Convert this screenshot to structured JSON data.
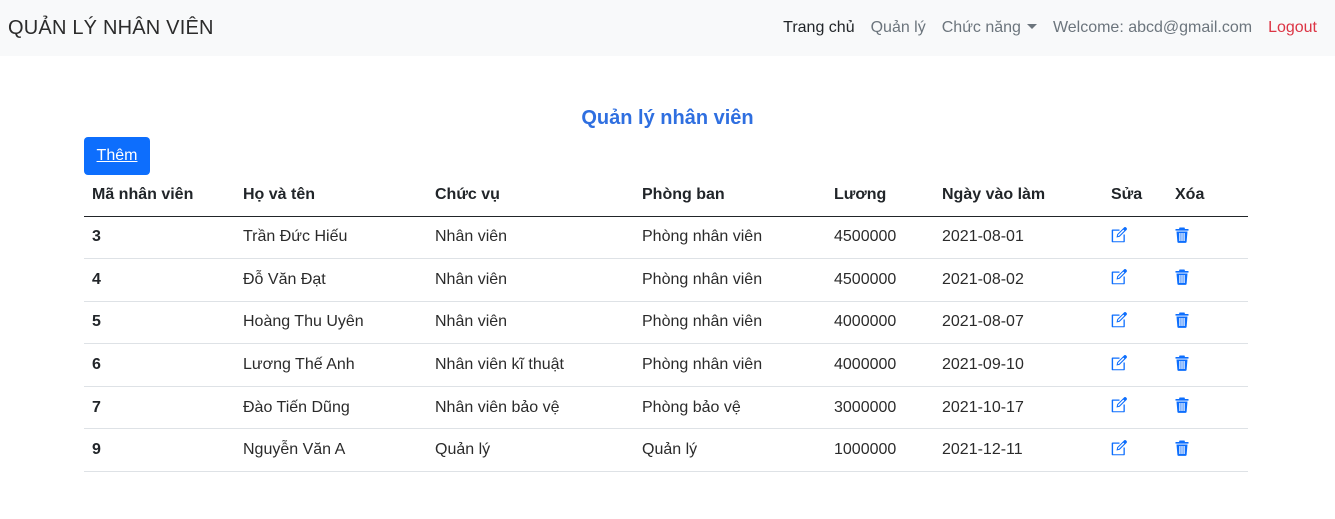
{
  "navbar": {
    "brand": "QUẢN LÝ NHÂN VIÊN",
    "links": {
      "home": "Trang chủ",
      "manage": "Quản lý",
      "functions": "Chức năng",
      "welcome": "Welcome: abcd@gmail.com",
      "logout": "Logout"
    }
  },
  "page": {
    "title": "Quản lý nhân viên",
    "add_button": "Thêm"
  },
  "table": {
    "headers": [
      "Mã nhân viên",
      "Họ và tên",
      "Chức vụ",
      "Phòng ban",
      "Lương",
      "Ngày vào làm",
      "Sửa",
      "Xóa"
    ],
    "rows": [
      [
        "3",
        "Trần Đức Hiếu",
        "Nhân viên",
        "Phòng nhân viên",
        "4500000",
        "2021-08-01"
      ],
      [
        "4",
        "Đỗ Văn Đạt",
        "Nhân viên",
        "Phòng nhân viên",
        "4500000",
        "2021-08-02"
      ],
      [
        "5",
        "Hoàng Thu Uyên",
        "Nhân viên",
        "Phòng nhân viên",
        "4000000",
        "2021-08-07"
      ],
      [
        "6",
        "Lương Thế Anh",
        "Nhân viên kĩ thuật",
        "Phòng nhân viên",
        "4000000",
        "2021-09-10"
      ],
      [
        "7",
        "Đào Tiến Dũng",
        "Nhân viên bảo vệ",
        "Phòng bảo vệ",
        "3000000",
        "2021-10-17"
      ],
      [
        "9",
        "Nguyễn Văn A",
        "Quản lý",
        "Quản lý",
        "1000000",
        "2021-12-11"
      ]
    ]
  },
  "icons": {
    "edit": "edit-icon",
    "delete": "trash-icon",
    "color": "#0d6efd"
  }
}
